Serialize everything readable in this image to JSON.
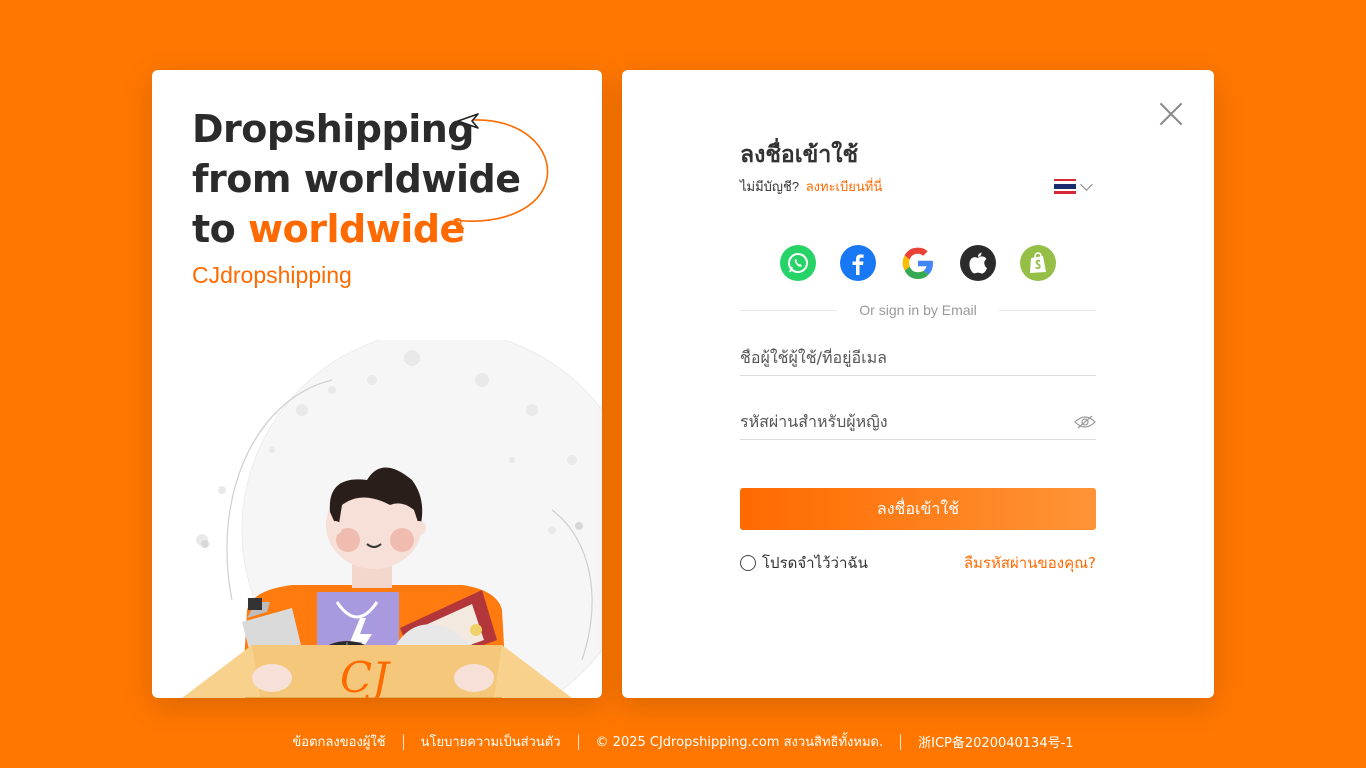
{
  "left_panel": {
    "headline_line1": "Dropshipping",
    "headline_line2": "from worldwide",
    "headline_line3_prefix": "to ",
    "headline_line3_accent": "worldwide",
    "brand": "CJdropshipping",
    "box_logo": "CJ"
  },
  "login": {
    "close_icon": "close-icon",
    "title": "ลงชื่อเข้าใช้",
    "no_account": "ไม่มีบัญชี?",
    "register_link": "ลงทะเบียนที่นี่",
    "language_flag": "thailand-flag-icon",
    "social_buttons": [
      "whatsapp-icon",
      "facebook-icon",
      "google-icon",
      "apple-icon",
      "shopify-icon"
    ],
    "divider_text": "Or sign in by Email",
    "username_placeholder": "ชื่อผู้ใช้ผู้ใช้/ที่อยู่อีเมล",
    "password_placeholder": "รหัสผ่านสำหรับผู้หญิง",
    "login_button": "ลงชื่อเข้าใช้",
    "remember_me": "โปรดจำไว้ว่าฉัน",
    "forgot_password": "ลืมรหัสผ่านของคุณ?"
  },
  "footer": {
    "terms": "ข้อตกลงของผู้ใช้",
    "privacy": "นโยบายความเป็นส่วนตัว",
    "copyright": "©  2025 CJdropshipping.com สงวนสิทธิทั้งหมด.",
    "icp": "浙ICP备2020040134号-1"
  },
  "colors": {
    "background": "#ff7700",
    "accent": "#ff6a00"
  }
}
